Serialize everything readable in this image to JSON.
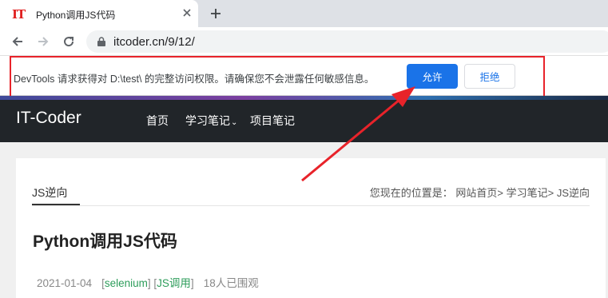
{
  "browser": {
    "tab_favicon": "IT",
    "tab_title": "Python调用JS代码",
    "url": "itcoder.cn/9/12/"
  },
  "infobar": {
    "message": "DevTools 请求获得对 D:\\test\\ 的完整访问权限。请确保您不会泄露任何敏感信息。",
    "allow_label": "允许",
    "deny_label": "拒绝"
  },
  "site": {
    "brand": "IT-Coder",
    "nav": {
      "home": "首页",
      "notes": "学习笔记",
      "projects": "项目笔记"
    }
  },
  "article": {
    "section_tab": "JS逆向",
    "breadcrumb": "您现在的位置是：  网站首页> 学习笔记> JS逆向",
    "title": "Python调用JS代码",
    "date": "2021-01-04",
    "tag1": "selenium",
    "tag2": "JS调用",
    "views": "18人已围观"
  },
  "colors": {
    "allow_button": "#1a73e8",
    "highlight": "#e8232a",
    "site_nav": "#212529",
    "tag": "#2e9d5b"
  }
}
